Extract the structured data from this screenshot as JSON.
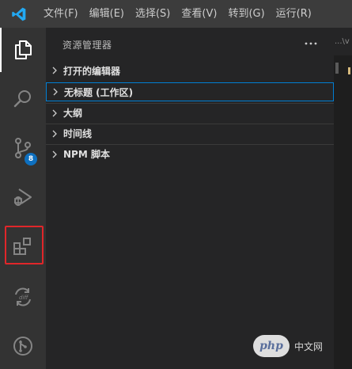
{
  "menu": {
    "items": [
      "文件(F)",
      "编辑(E)",
      "选择(S)",
      "查看(V)",
      "转到(G)",
      "运行(R)"
    ]
  },
  "activity_bar": {
    "items": [
      {
        "name": "explorer",
        "icon": "files-icon",
        "active": true
      },
      {
        "name": "search",
        "icon": "search-icon"
      },
      {
        "name": "source-control",
        "icon": "source-control-icon",
        "badge": "8"
      },
      {
        "name": "run-debug",
        "icon": "run-debug-icon"
      },
      {
        "name": "extensions",
        "icon": "extensions-icon",
        "highlighted": true
      },
      {
        "name": "compare",
        "icon": "diff-sync-icon"
      },
      {
        "name": "git-graph",
        "icon": "git-graph-icon"
      }
    ],
    "source_control_badge": "8",
    "highlight_color": "#e0262a"
  },
  "sidebar": {
    "title": "资源管理器",
    "sections": [
      {
        "label": "打开的编辑器"
      },
      {
        "label": "无标题 (工作区)",
        "focused": true
      },
      {
        "label": "大纲"
      },
      {
        "label": "时间线"
      },
      {
        "label": "NPM 脚本"
      }
    ]
  },
  "editor": {
    "tab_peek": "...\\v"
  },
  "watermark": {
    "logo_text": "php",
    "text": "中文网"
  },
  "colors": {
    "titlebar": "#3c3c3c",
    "activitybar": "#333333",
    "sidebar": "#252526",
    "editor": "#1e1e1e",
    "focus_border": "#007fd4",
    "badge": "#0e70c0",
    "vscode_blue": "#23a9f2"
  }
}
